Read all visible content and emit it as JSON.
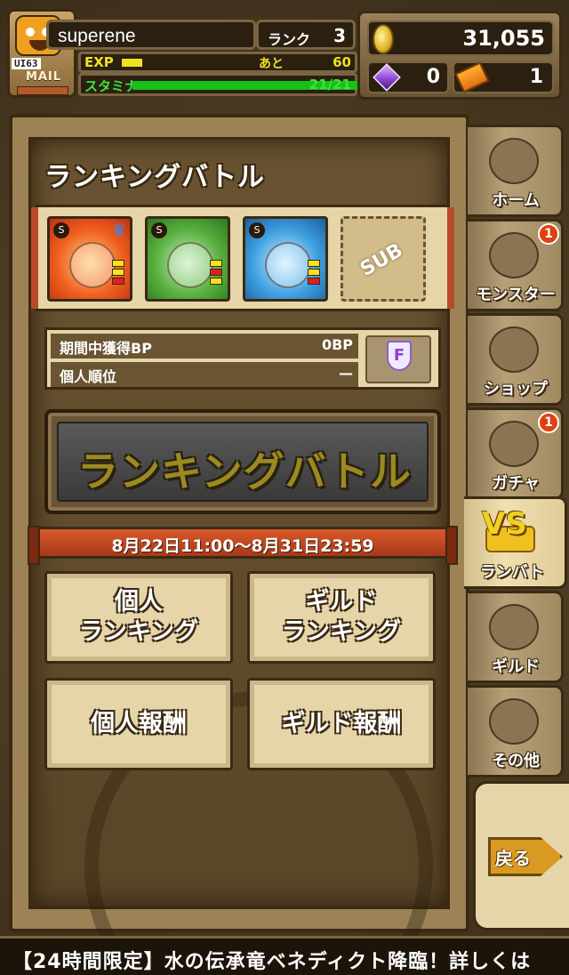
{
  "header": {
    "mail_label": "MAIL",
    "site_mark": "UI63",
    "player_name": "superene",
    "rank_label": "ランク",
    "rank_value": "3",
    "exp_label": "EXP",
    "exp_progress": 0.18,
    "exp_remaining_label": "あと",
    "exp_remaining_value": "60",
    "stamina_label": "スタミナ",
    "stamina_value": "21/21",
    "stamina_progress": 1.0,
    "coins": "31,055",
    "gems": "0",
    "tickets": "1"
  },
  "main": {
    "title": "ランキングバトル",
    "team": {
      "slots": [
        {
          "element": "fire",
          "element_glyph": "S",
          "leader": true,
          "stars": 3
        },
        {
          "element": "wood",
          "element_glyph": "S",
          "leader": false,
          "stars": 3
        },
        {
          "element": "water",
          "element_glyph": "S",
          "leader": false,
          "stars": 3
        }
      ],
      "sub_label": "SUB"
    },
    "stats": {
      "bp_label": "期間中獲得BP",
      "bp_value": "0BP",
      "rank_label": "個人順位",
      "rank_value": "—",
      "grade_badge": "F"
    },
    "battle_button_label": "ランキングバトル",
    "period": "8月22日11:00〜8月31日23:59",
    "menu": {
      "personal_ranking": "個人\nランキング",
      "guild_ranking": "ギルド\nランキング",
      "personal_reward": "個人報酬",
      "guild_reward": "ギルド報酬"
    }
  },
  "nav": {
    "items": [
      {
        "label": "ホーム",
        "icon": "home-icon",
        "badge": ""
      },
      {
        "label": "モンスター",
        "icon": "monster-icon",
        "badge": "1"
      },
      {
        "label": "ショップ",
        "icon": "shop-icon",
        "badge": ""
      },
      {
        "label": "ガチャ",
        "icon": "gacha-icon",
        "badge": "1"
      },
      {
        "label": "ランバト",
        "icon": "vs-icon",
        "badge": "",
        "vs_text": "VS"
      },
      {
        "label": "ギルド",
        "icon": "guild-icon",
        "badge": ""
      },
      {
        "label": "その他",
        "icon": "gear-icon",
        "badge": ""
      }
    ],
    "back_label": "戻る"
  },
  "ticker": {
    "text": "【24時間限定】水の伝承竜ベネディクト降臨！詳しくは"
  }
}
